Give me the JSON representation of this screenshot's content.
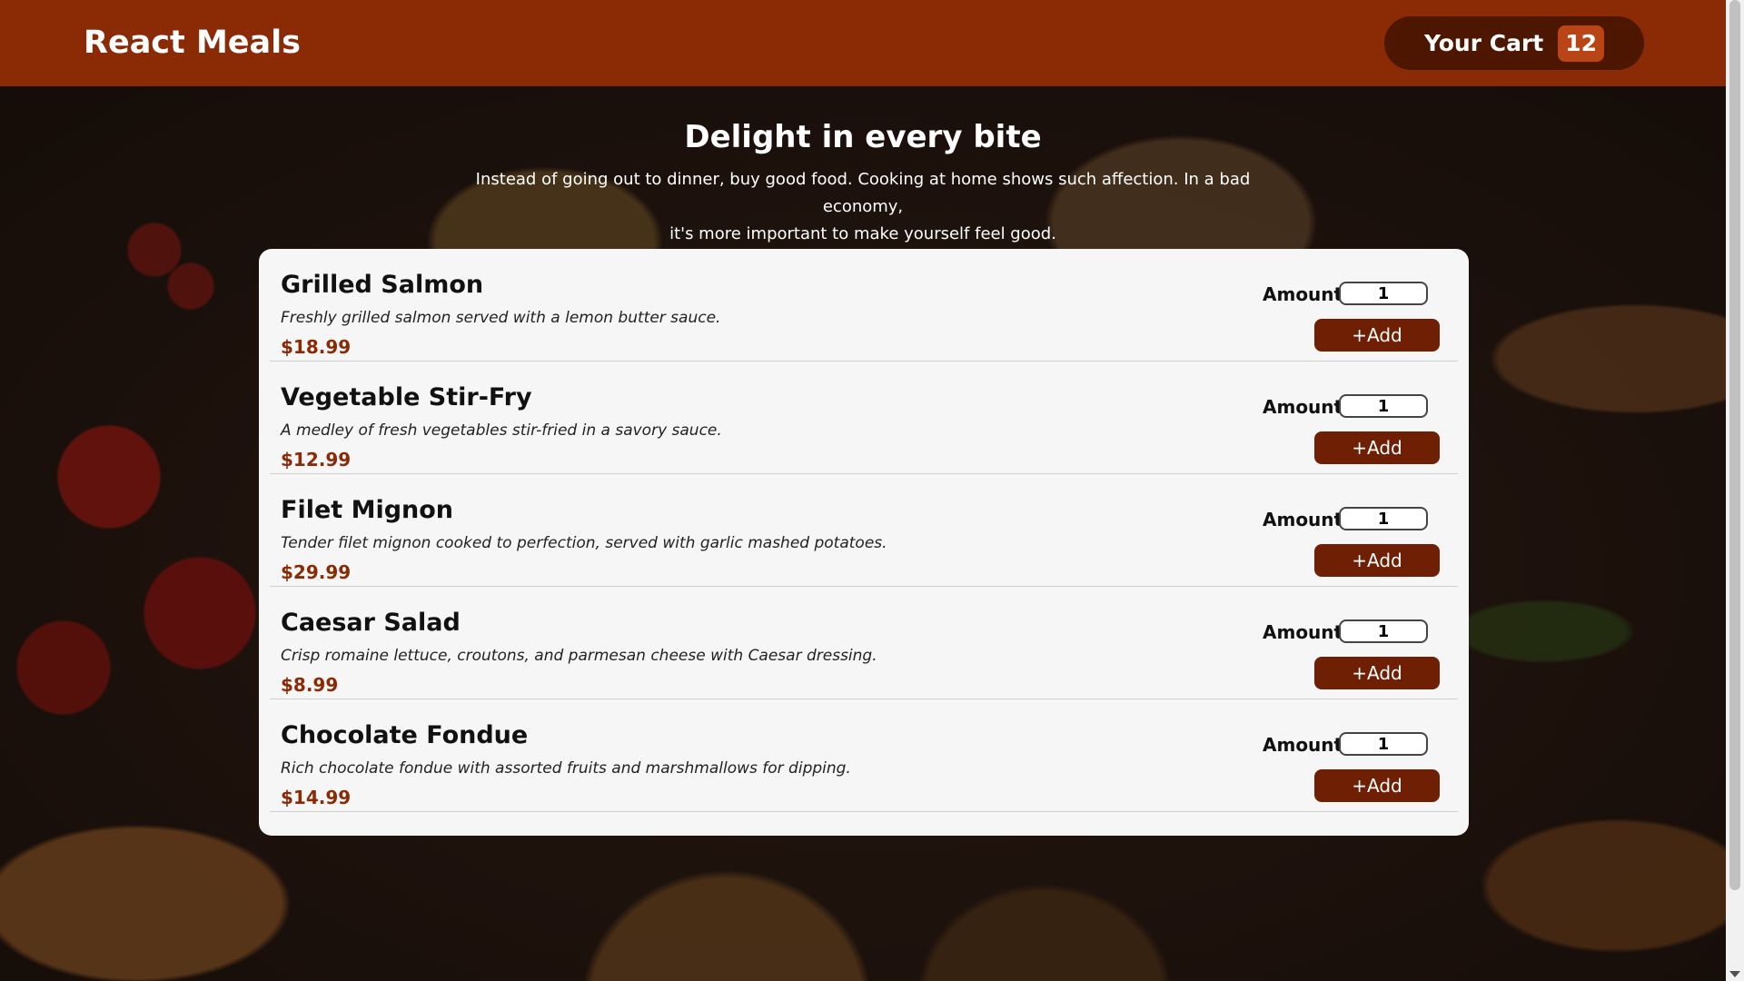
{
  "header": {
    "brand": "React Meals",
    "cart_label": "Your Cart",
    "cart_count": "12"
  },
  "summary": {
    "title": "Delight in every bite",
    "text_line1": "Instead of going out to dinner, buy good food. Cooking at home shows such affection. In a bad economy,",
    "text_line2": "it's more important to make yourself feel good."
  },
  "meals": [
    {
      "name": "Grilled Salmon",
      "description": "Freshly grilled salmon served with a lemon butter sauce.",
      "price": "$18.99",
      "amount_label": "Amount",
      "amount": "1",
      "add_label": "+Add"
    },
    {
      "name": "Vegetable Stir-Fry",
      "description": "A medley of fresh vegetables stir-fried in a savory sauce.",
      "price": "$12.99",
      "amount_label": "Amount",
      "amount": "1",
      "add_label": "+Add"
    },
    {
      "name": "Filet Mignon",
      "description": "Tender filet mignon cooked to perfection, served with garlic mashed potatoes.",
      "price": "$29.99",
      "amount_label": "Amount",
      "amount": "1",
      "add_label": "+Add"
    },
    {
      "name": "Caesar Salad",
      "description": "Crisp romaine lettuce, croutons, and parmesan cheese with Caesar dressing.",
      "price": "$8.99",
      "amount_label": "Amount",
      "amount": "1",
      "add_label": "+Add"
    },
    {
      "name": "Chocolate Fondue",
      "description": "Rich chocolate fondue with assorted fruits and marshmallows for dipping.",
      "price": "$14.99",
      "amount_label": "Amount",
      "amount": "1",
      "add_label": "+Add"
    }
  ],
  "colors": {
    "header_bg": "#8a2b06",
    "cart_button_bg": "#4d1601",
    "badge_bg": "#b94517",
    "price_color": "#8a2b06",
    "add_button_bg": "#6e1f04"
  }
}
